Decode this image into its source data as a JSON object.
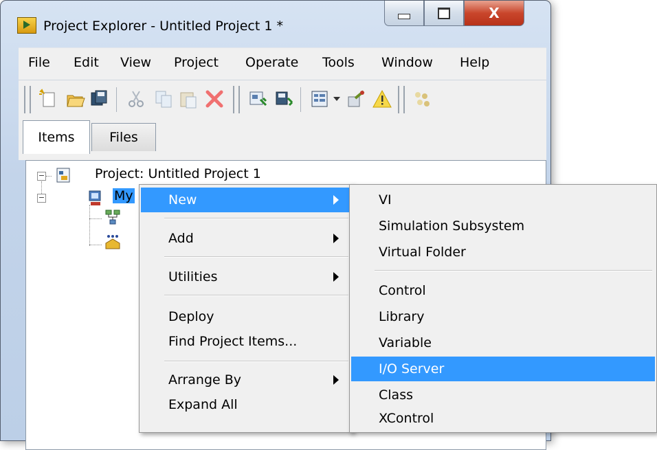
{
  "window": {
    "title": "Project Explorer - Untitled Project 1 *",
    "caption_buttons": {
      "minimize": "minimize",
      "maximize": "maximize",
      "close": "X"
    }
  },
  "menubar": {
    "items": [
      "File",
      "Edit",
      "View",
      "Project",
      "Operate",
      "Tools",
      "Window",
      "Help"
    ]
  },
  "toolbar": {
    "icons": [
      "new-icon",
      "open-icon",
      "save-all-icon",
      "cut-icon",
      "copy-icon",
      "paste-icon",
      "delete-icon",
      "build-icon",
      "save-build-icon",
      "view-icon",
      "dropdown-icon",
      "properties-icon",
      "warning-icon",
      "deploy-icon"
    ]
  },
  "tabs": [
    "Items",
    "Files"
  ],
  "tree": {
    "root_label": "Project: Untitled Project 1",
    "target_label": "My"
  },
  "context_menu": {
    "items": [
      {
        "label": "New",
        "submenu": true,
        "highlight": true
      },
      {
        "label": "Add",
        "submenu": true
      },
      {
        "label": "Utilities",
        "submenu": true
      },
      {
        "label": "Deploy",
        "submenu": false
      },
      {
        "label": "Find Project Items...",
        "submenu": false
      },
      {
        "label": "Arrange By",
        "submenu": true
      },
      {
        "label": "Expand All",
        "submenu": false
      }
    ]
  },
  "submenu": {
    "items": [
      {
        "label": "VI"
      },
      {
        "label": "Simulation Subsystem"
      },
      {
        "label": "Virtual Folder"
      },
      {
        "label": "Control"
      },
      {
        "label": "Library"
      },
      {
        "label": "Variable"
      },
      {
        "label": "I/O Server",
        "highlight": true
      },
      {
        "label": "Class"
      },
      {
        "label": "XControl"
      }
    ]
  },
  "colors": {
    "highlight": "#3399ff",
    "menu_bg": "#f0f0f0",
    "frame": "#c3d4ea",
    "close_button": "#c9462c"
  }
}
